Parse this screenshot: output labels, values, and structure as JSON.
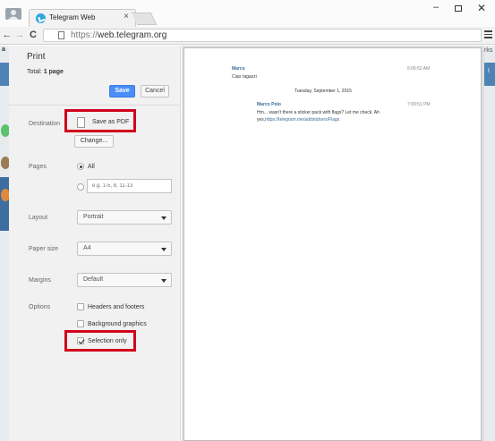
{
  "browser": {
    "tab_title": "Telegram Web",
    "tab_close": "×",
    "url_scheme": "https://",
    "url_host": "web.telegram.org",
    "icons": [
      "user-icon",
      "telegram-icon",
      "back-icon",
      "forward-icon",
      "reload-icon",
      "page-icon",
      "menu-icon"
    ],
    "window_controls": {
      "minimize": "–",
      "close": "✕"
    }
  },
  "background_page": {
    "left_letter": "a",
    "right_text": "rks",
    "right_letter": "t"
  },
  "print": {
    "title": "Print",
    "total_label": "Total: ",
    "total_value": "1 page",
    "save_label": "Save",
    "cancel_label": "Cancel",
    "destination": {
      "label": "Destination",
      "value": "Save as PDF",
      "change_label": "Change..."
    },
    "pages": {
      "label": "Pages",
      "all_label": "All",
      "all_selected": true,
      "custom_placeholder": "e.g. 1-5, 8, 11-13"
    },
    "layout": {
      "label": "Layout",
      "value": "Portrait"
    },
    "paper_size": {
      "label": "Paper size",
      "value": "A4"
    },
    "margins": {
      "label": "Margins",
      "value": "Default"
    },
    "options": {
      "label": "Options",
      "items": [
        {
          "label": "Headers and footers",
          "checked": false
        },
        {
          "label": "Background graphics",
          "checked": false
        },
        {
          "label": "Selection only",
          "checked": true
        }
      ]
    },
    "highlight_color": "#d0021b",
    "accent_color": "#4b8df8"
  },
  "preview": {
    "messages": [
      {
        "sender": "Marco",
        "text": "Ciao ragazzi",
        "time": "5:06:52 AM"
      },
      {
        "sender": "Marco Polo",
        "text": "Hm... wasn't there a sticker pack with flags? Let me check. Ah",
        "text2": "yes,",
        "link": "https://telegram.me/addstickers/Flags",
        "time": "7:09:51 PM"
      }
    ],
    "date_separator": "Tuesday, September 1, 2015"
  }
}
